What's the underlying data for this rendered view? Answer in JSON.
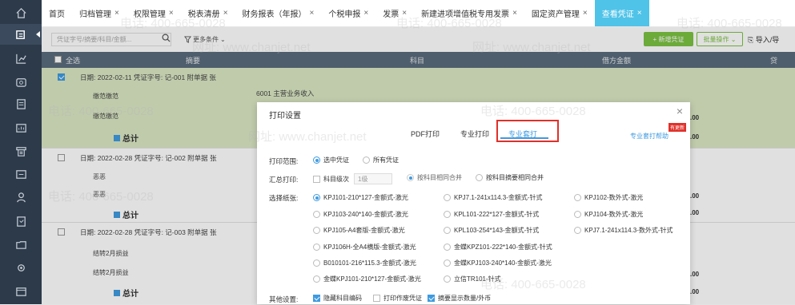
{
  "sidebar": {
    "icons": [
      "home-icon",
      "voucher-icon",
      "chart-icon",
      "wallet-icon",
      "ledger-icon",
      "report-icon",
      "print-icon",
      "invoice-icon",
      "people-icon",
      "document-icon",
      "folder-icon",
      "gear-icon",
      "box-icon"
    ]
  },
  "tabs": [
    {
      "label": "首页",
      "close": ""
    },
    {
      "label": "归档管理",
      "close": "×"
    },
    {
      "label": "权限管理",
      "close": "×"
    },
    {
      "label": "税表清册",
      "close": "×"
    },
    {
      "label": "财务报表（年报）",
      "close": "×"
    },
    {
      "label": "个税申报",
      "close": "×"
    },
    {
      "label": "发票",
      "close": "×"
    },
    {
      "label": "新建进项增值税专用发票",
      "close": "×"
    },
    {
      "label": "固定资产管理",
      "close": "×"
    },
    {
      "label": "查看凭证",
      "close": "×"
    }
  ],
  "toolbar": {
    "search_placeholder": "凭证字号/摘要/科目/金额...",
    "filter_label": "更多条件",
    "add_label": "+ 新增凭证",
    "batch_label": "批量操作",
    "import_label": "导入/导"
  },
  "table": {
    "select_all": "全选",
    "col_summary": "摘要",
    "col_subject": "科目",
    "col_debit": "借方金额",
    "col_credit": "贷"
  },
  "groups": [
    {
      "header": "日期: 2022-02-11  凭证字号: 记-001  附单据 张",
      "lines": [
        "缴范缴范",
        "缴范缴范"
      ],
      "subject": "6001 主营业务收入",
      "sum": "总计",
      "amt1": ".00",
      "amt2": ".00"
    },
    {
      "header": "日期: 2022-02-28  凭证字号: 记-002  附单据 张",
      "lines": [
        "恶恶",
        "恶恶"
      ],
      "subject": "",
      "sum": "总计",
      "amt1": ".00",
      "amt2": ".00"
    },
    {
      "header": "日期: 2022-02-28  凭证字号: 记-003  附单据 张",
      "lines": [
        "结转2月损益",
        "结转2月损益"
      ],
      "subject": "",
      "sum": "总计",
      "amt1": ".00",
      "amt2": ".00"
    }
  ],
  "modal": {
    "title": "打印设置",
    "close": "×",
    "tabs": [
      "PDF打印",
      "专业打印",
      "专业套打"
    ],
    "help": "专业套打帮助",
    "badge": "有更新",
    "range_label": "打印范围:",
    "range_opts": [
      "选中凭证",
      "所有凭证"
    ],
    "sum_label": "汇总打印:",
    "sum_level": "科目级次",
    "sum_level_val": "1级",
    "sum_opts": [
      "按科目相同合并",
      "按科目摘要相同合并"
    ],
    "paper_label": "选择纸张:",
    "papers": [
      "KPJ101-210*127-金额式-激光",
      "KPJ7.1-241x114.3-金额式-针式",
      "KPJ102-数外式-激光",
      "KPJ103-240*140-金额式-激光",
      "KPL101-222*127-金额式-针式",
      "KPJ104-数外式-激光",
      "KPJ105-A4套版-金额式-激光",
      "KPL103-254*143-金额式-针式",
      "KPJ7.1-241x114.3-数外式-针式",
      "KPJ106H-全A4横版-金额式-激光",
      "金蝶KPZ101-222*140-金额式-针式",
      "",
      "B010101-216*115.3-金额式-激光",
      "金蝶KPJ103-240*140-金额式-激光",
      "",
      "金蝶KPJ101-210*127-金额式-激光",
      "立信TR101-针式",
      ""
    ],
    "other_label": "其他设置:",
    "other_opts": [
      "隐藏科目编码",
      "打印作废凭证",
      "摘要显示数量/外币"
    ]
  },
  "watermark": {
    "phone": "电话: 400-665-0028",
    "site": "网址: www.chanjet.net"
  }
}
